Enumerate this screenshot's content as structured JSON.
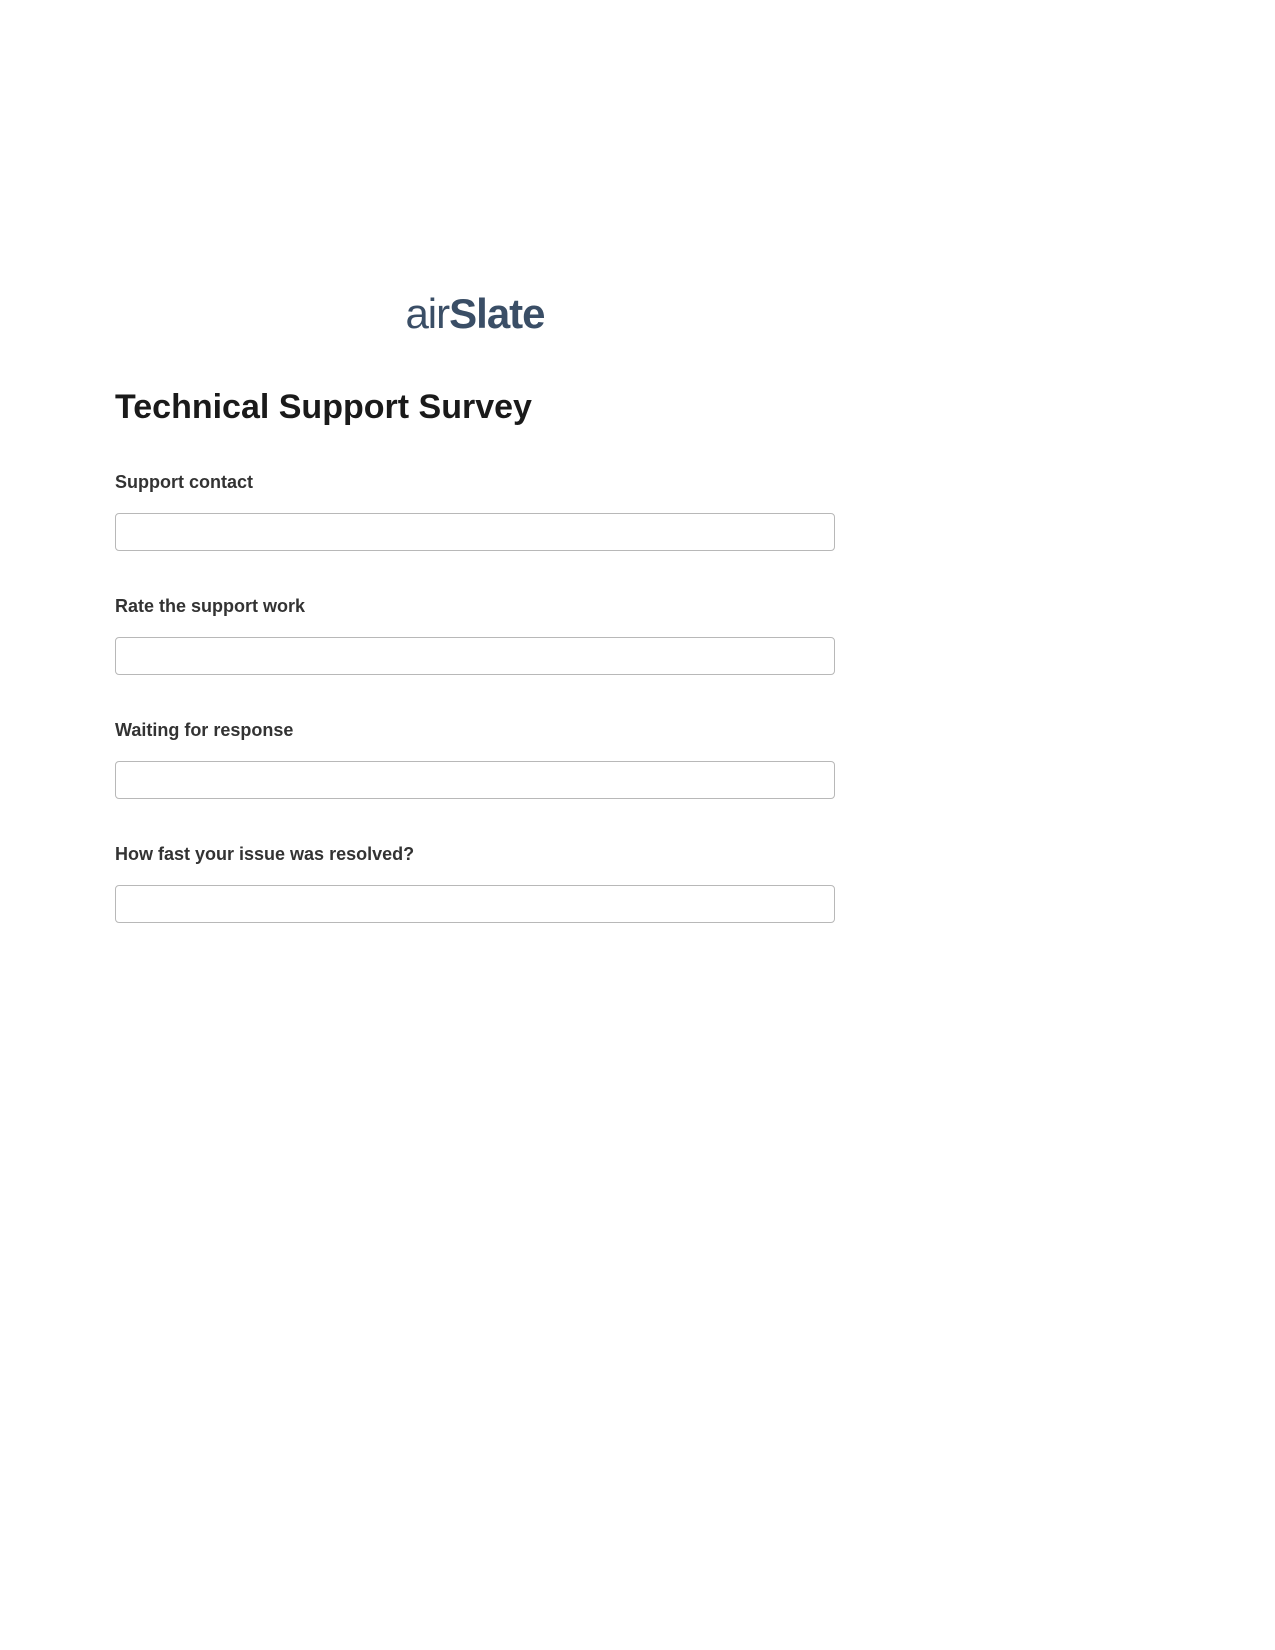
{
  "logo": {
    "part1": "air",
    "part2": "Slate"
  },
  "title": "Technical Support Survey",
  "fields": [
    {
      "label": "Support contact",
      "value": ""
    },
    {
      "label": "Rate the support work",
      "value": ""
    },
    {
      "label": "Waiting for response",
      "value": ""
    },
    {
      "label": "How fast your issue was resolved?",
      "value": ""
    }
  ]
}
